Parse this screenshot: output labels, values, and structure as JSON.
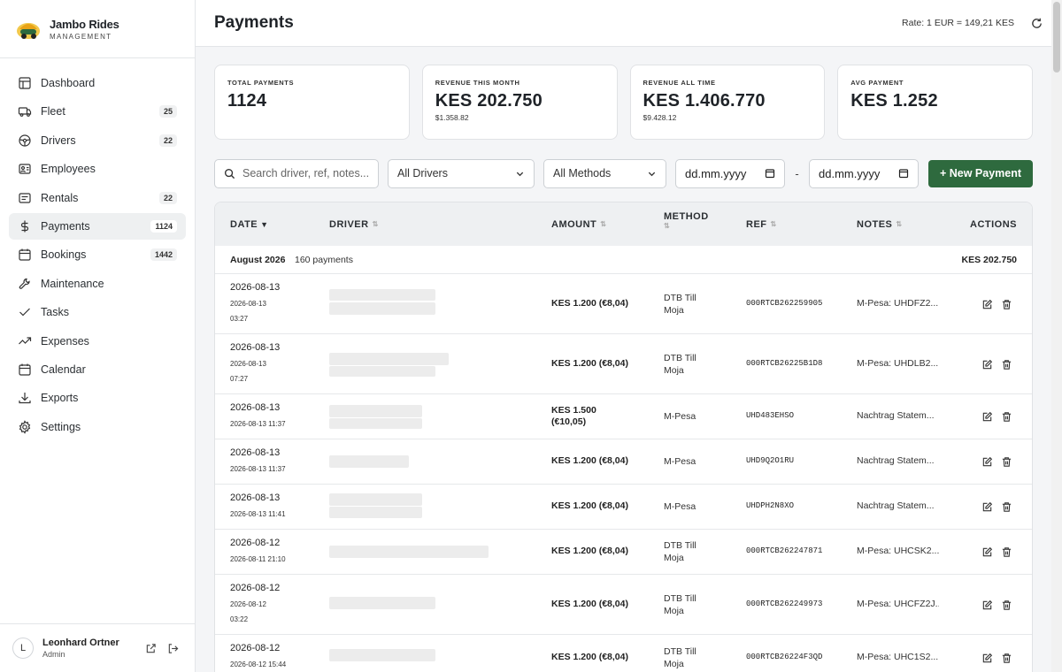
{
  "brand": {
    "name": "Jambo Rides",
    "sub": "MANAGEMENT"
  },
  "nav": [
    {
      "label": "Dashboard",
      "icon": "dashboard-icon",
      "badge": ""
    },
    {
      "label": "Fleet",
      "icon": "car-icon",
      "badge": "25"
    },
    {
      "label": "Drivers",
      "icon": "steering-wheel-icon",
      "badge": "22"
    },
    {
      "label": "Employees",
      "icon": "users-icon",
      "badge": ""
    },
    {
      "label": "Rentals",
      "icon": "key-icon",
      "badge": "22"
    },
    {
      "label": "Payments",
      "icon": "dollar-icon",
      "badge": "1124",
      "active": true
    },
    {
      "label": "Bookings",
      "icon": "calendar-check-icon",
      "badge": "1442"
    },
    {
      "label": "Maintenance",
      "icon": "wrench-icon",
      "badge": ""
    },
    {
      "label": "Tasks",
      "icon": "checklist-icon",
      "badge": ""
    },
    {
      "label": "Expenses",
      "icon": "receipt-icon",
      "badge": ""
    },
    {
      "label": "Calendar",
      "icon": "calendar-icon",
      "badge": ""
    },
    {
      "label": "Exports",
      "icon": "download-icon",
      "badge": ""
    },
    {
      "label": "Settings",
      "icon": "gear-icon",
      "badge": ""
    }
  ],
  "user": {
    "initial": "L",
    "name": "Leonhard Ortner",
    "role": "Admin"
  },
  "header": {
    "title": "Payments",
    "rate": "Rate: 1 EUR = 149,21 KES"
  },
  "stats": [
    {
      "label": "Total Payments",
      "value": "1124",
      "sub": ""
    },
    {
      "label": "Revenue this month",
      "value": "KES 202.750",
      "sub": "$1.358.82"
    },
    {
      "label": "Revenue all time",
      "value": "KES 1.406.770",
      "sub": "$9.428.12"
    },
    {
      "label": "Avg payment",
      "value": "KES 1.252",
      "sub": ""
    }
  ],
  "filters": {
    "search_placeholder": "Search driver, ref, notes...",
    "drivers_selected": "All Drivers",
    "methods_selected": "All Methods",
    "date_from": "dd.mm.yyyy",
    "date_separator": "-",
    "date_to": "dd.mm.yyyy",
    "new_button": "+ New Payment"
  },
  "table": {
    "columns": {
      "date": "Date",
      "date_sort": "▼",
      "driver": "Driver",
      "amount": "Amount",
      "method": "Method",
      "ref": "Ref",
      "notes": "Notes",
      "actions": "Actions"
    },
    "group": {
      "label": "August 2026",
      "count": "160 payments",
      "total": "KES 202.750"
    },
    "rows": [
      {
        "date": "2026-08-13",
        "sub": "2026-08-13 03:27",
        "amount": "KES 1.200 (€8,04)",
        "method": "DTB Till Moja",
        "ref": "000RTCB262259905",
        "notes": "M-Pesa: UHDFZ2..."
      },
      {
        "date": "2026-08-13",
        "sub": "2026-08-13 07:27",
        "amount": "KES 1.200 (€8,04)",
        "method": "DTB Till Moja",
        "ref": "000RTCB26225B1D8",
        "notes": "M-Pesa: UHDLB2..."
      },
      {
        "date": "2026-08-13",
        "sub": "2026-08-13 11:37",
        "amount": "KES 1.500 (€10,05)",
        "method": "M-Pesa",
        "ref": "UHD483EHSO",
        "notes": "Nachtrag Statem..."
      },
      {
        "date": "2026-08-13",
        "sub": "2026-08-13 11:37",
        "amount": "KES 1.200 (€8,04)",
        "method": "M-Pesa",
        "ref": "UHD9Q2O1RU",
        "notes": "Nachtrag Statem..."
      },
      {
        "date": "2026-08-13",
        "sub": "2026-08-13 11:41",
        "amount": "KES 1.200 (€8,04)",
        "method": "M-Pesa",
        "ref": "UHDPH2N8XO",
        "notes": "Nachtrag Statem..."
      },
      {
        "date": "2026-08-12",
        "sub": "2026-08-11 21:10",
        "amount": "KES 1.200 (€8,04)",
        "method": "DTB Till Moja",
        "ref": "000RTCB262247871",
        "notes": "M-Pesa: UHCSK2..."
      },
      {
        "date": "2026-08-12",
        "sub": "2026-08-12 03:22",
        "amount": "KES 1.200 (€8,04)",
        "method": "DTB Till Moja",
        "ref": "000RTCB262249973",
        "notes": "M-Pesa: UHCFZ2J..."
      },
      {
        "date": "2026-08-12",
        "sub": "2026-08-12 15:44",
        "amount": "KES 1.200 (€8,04)",
        "method": "DTB Till Moja",
        "ref": "000RTCB26224F3QD",
        "notes": "M-Pesa: UHC1S2..."
      }
    ]
  },
  "colors": {
    "accent": "#2e6a3e",
    "active_nav": "#eef0f1",
    "header_bg": "#eef0f2"
  }
}
